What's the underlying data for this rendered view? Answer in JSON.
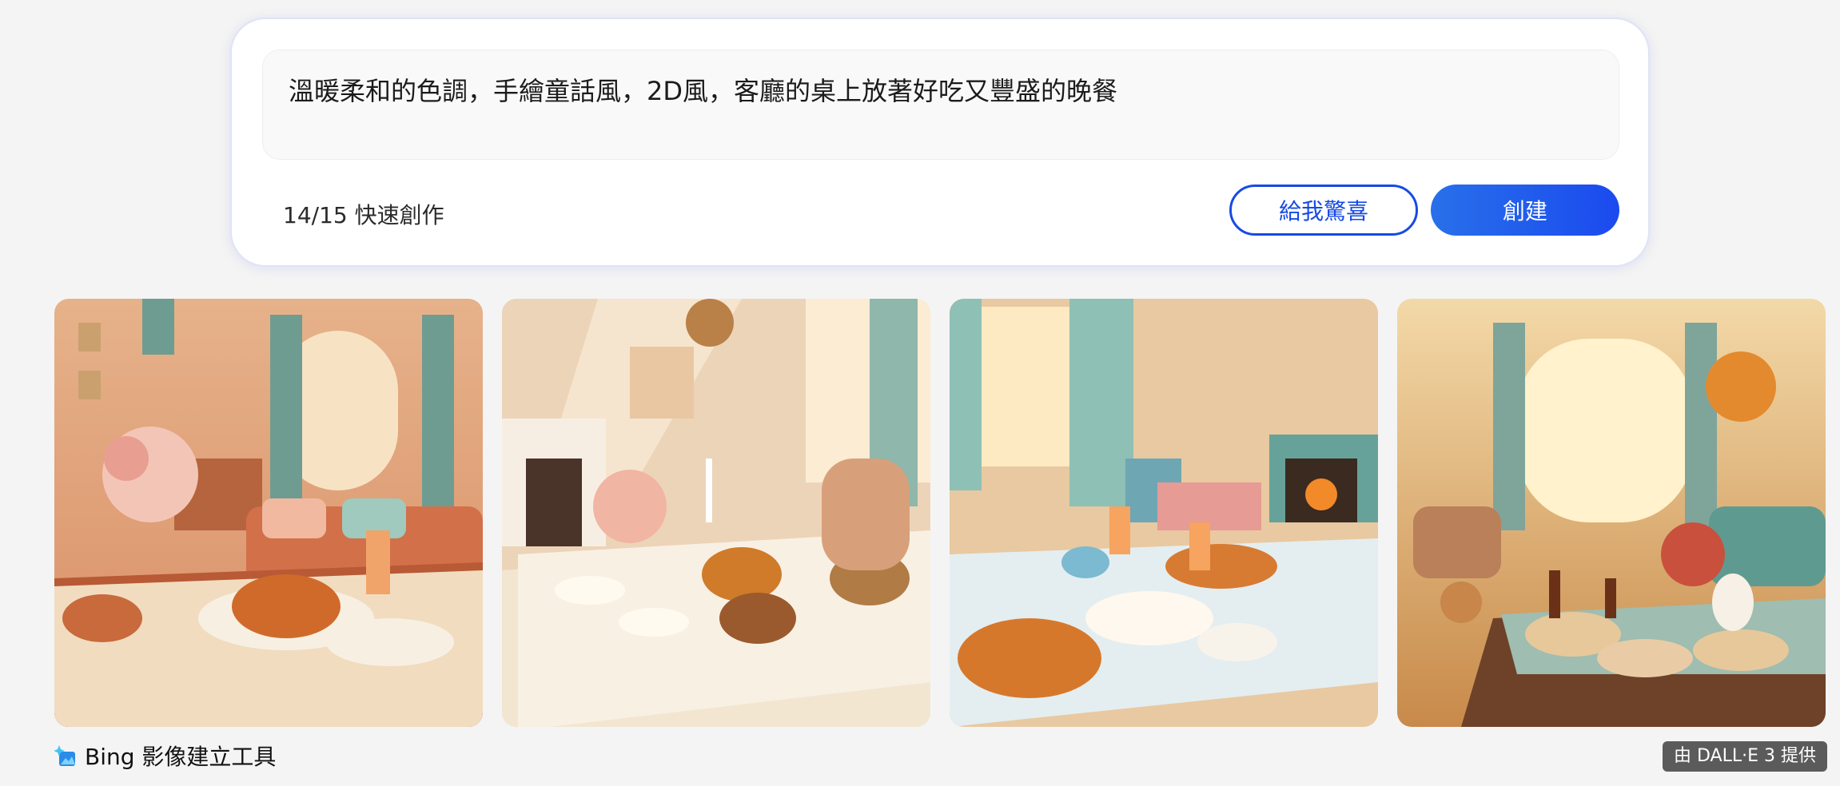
{
  "prompt": {
    "text": "溫暖柔和的色調，手繪童話風，2D風，客廳的桌上放著好吃又豐盛的晚餐"
  },
  "boosts": {
    "label": "14/15 快速創作"
  },
  "buttons": {
    "surprise_label": "給我驚喜",
    "create_label": "創建"
  },
  "colors": {
    "accent": "#174ae4",
    "create_gradient_start": "#2870ea",
    "create_gradient_end": "#1b4aef"
  },
  "results": {
    "image_count": 4
  },
  "footer": {
    "brand_icon": "bing-image-creator-icon",
    "brand_label": "Bing 影像建立工具",
    "badge_label": "由 DALL·E 3 提供"
  }
}
